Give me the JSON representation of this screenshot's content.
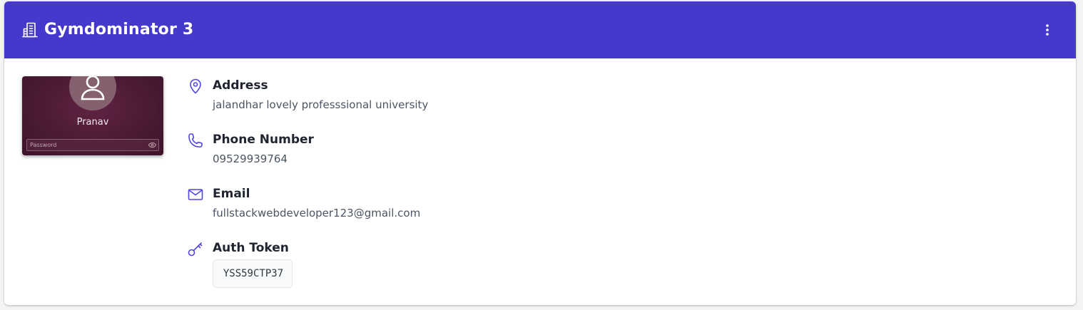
{
  "header": {
    "title": "Gymdominator 3",
    "brand_icon": "building-icon",
    "menu_icon": "vertical-dots-icon",
    "background_color": "#4439cc"
  },
  "preview": {
    "user_name": "Pranav",
    "password_placeholder": "Password",
    "avatar_icon": "user-icon",
    "reveal_icon": "eye-icon"
  },
  "details": {
    "address": {
      "label": "Address",
      "value": "jalandhar lovely professsional university",
      "icon": "location-pin-icon"
    },
    "phone": {
      "label": "Phone Number",
      "value": "09529939764",
      "icon": "phone-icon"
    },
    "email": {
      "label": "Email",
      "value": "fullstackwebdeveloper123@gmail.com",
      "icon": "mail-icon"
    },
    "auth_token": {
      "label": "Auth Token",
      "value": "YSS59CTP37",
      "icon": "key-icon"
    }
  },
  "colors": {
    "accent": "#4439cc",
    "icon": "#4f46e5"
  }
}
